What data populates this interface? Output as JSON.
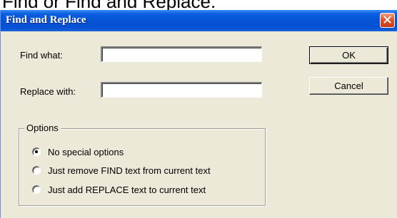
{
  "background_caption": "Find or Find and Replace.",
  "window": {
    "title": "Find and Replace",
    "close_icon": "close-icon",
    "accent_color": "#0553d6",
    "close_color": "#e2502a"
  },
  "fields": {
    "find_label": "Find what:",
    "find_value": "",
    "replace_label": "Replace with:",
    "replace_value": ""
  },
  "buttons": {
    "ok_label": "OK",
    "cancel_label": "Cancel"
  },
  "options": {
    "group_label": "Options",
    "items": [
      {
        "label": "No special options",
        "selected": true
      },
      {
        "label": "Just remove FIND text from current text",
        "selected": false
      },
      {
        "label": "Just add REPLACE text to current text",
        "selected": false
      }
    ]
  }
}
